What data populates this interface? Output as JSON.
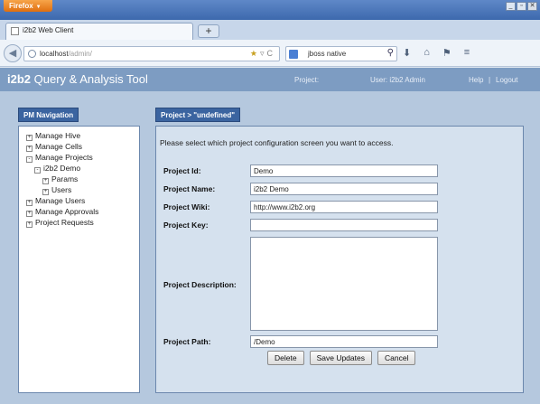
{
  "browser": {
    "menu_button": "Firefox",
    "window_controls": [
      "_",
      "▫",
      "✕"
    ],
    "tab_title": "i2b2 Web Client",
    "new_tab": "+",
    "url": "localhost",
    "url_path": "/admin/",
    "search_text": "jboss native",
    "toolbar_icons": [
      "download-icon",
      "home-icon",
      "bookmark-icon",
      "menu-icon"
    ]
  },
  "app": {
    "logo_bold": "i2b2",
    "logo_text": " Query & Analysis Tool",
    "project_link": "Project:",
    "user_label": "User: i2b2 Admin",
    "help_link": "Help",
    "separator": "|",
    "logout_link": "Logout"
  },
  "nav": {
    "title": "PM Navigation",
    "items": [
      {
        "label": "Manage Hive",
        "indent": 0,
        "box": "+"
      },
      {
        "label": "Manage Cells",
        "indent": 0,
        "box": "+"
      },
      {
        "label": "Manage Projects",
        "indent": 0,
        "box": "-"
      },
      {
        "label": "i2b2 Demo",
        "indent": 1,
        "box": "-"
      },
      {
        "label": "Params",
        "indent": 2,
        "box": "+"
      },
      {
        "label": "Users",
        "indent": 2,
        "box": "+"
      },
      {
        "label": "Manage Users",
        "indent": 0,
        "box": "+"
      },
      {
        "label": "Manage Approvals",
        "indent": 0,
        "box": "+"
      },
      {
        "label": "Project Requests",
        "indent": 0,
        "box": "+"
      }
    ]
  },
  "project": {
    "title": "Project > \"undefined\"",
    "intro": "Please select which project configuration screen you want to access.",
    "fields": {
      "id": {
        "label": "Project Id:",
        "value": "Demo"
      },
      "name": {
        "label": "Project Name:",
        "value": "i2b2 Demo"
      },
      "wiki": {
        "label": "Project Wiki:",
        "value": "http://www.i2b2.org"
      },
      "key": {
        "label": "Project Key:",
        "value": ""
      },
      "description": {
        "label": "Project Description:",
        "value": ""
      },
      "path": {
        "label": "Project Path:",
        "value": "/Demo"
      }
    },
    "buttons": {
      "delete": "Delete",
      "save": "Save Updates",
      "cancel": "Cancel"
    }
  },
  "colors": {
    "header": "#7d9cc2",
    "panel_title": "#3b64a0",
    "main_bg": "#b5c8de"
  }
}
